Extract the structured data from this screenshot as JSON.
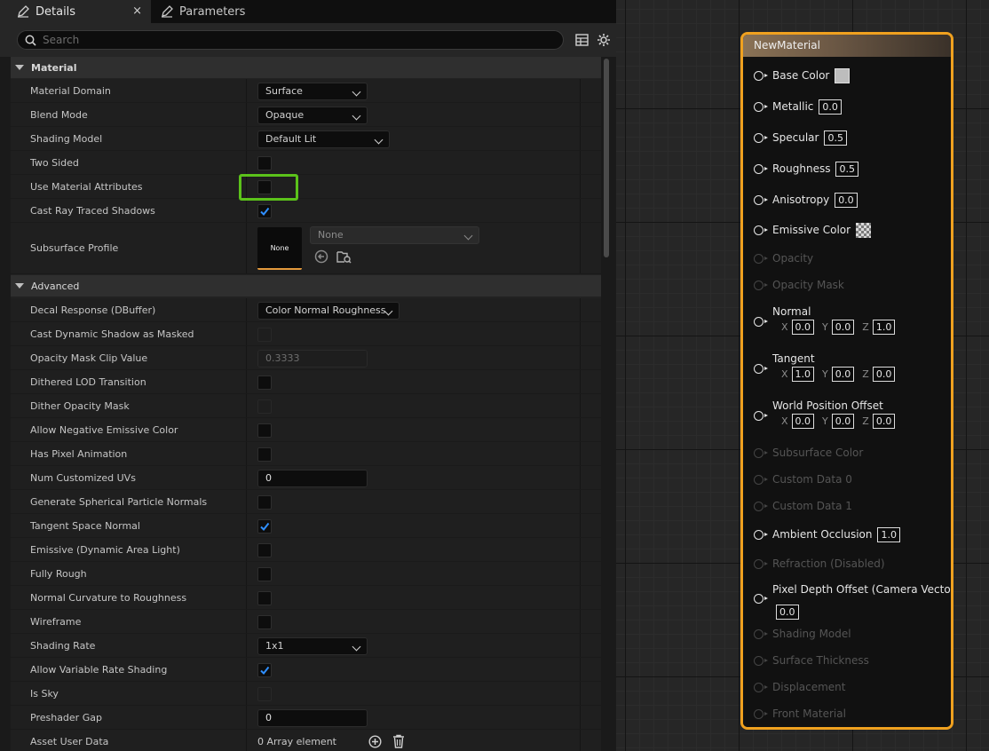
{
  "tabs": {
    "details": "Details",
    "parameters": "Parameters",
    "close": "×"
  },
  "search": {
    "placeholder": "Search"
  },
  "material_category": "Material",
  "advanced_category": "Advanced",
  "props": {
    "material_domain": {
      "label": "Material Domain",
      "value": "Surface"
    },
    "blend_mode": {
      "label": "Blend Mode",
      "value": "Opaque"
    },
    "shading_model": {
      "label": "Shading Model",
      "value": "Default Lit"
    },
    "two_sided": {
      "label": "Two Sided",
      "checked": false
    },
    "use_material_attributes": {
      "label": "Use Material Attributes",
      "checked": false
    },
    "cast_ray_traced_shadows": {
      "label": "Cast Ray Traced Shadows",
      "checked": true
    },
    "subsurface_profile": {
      "label": "Subsurface Profile",
      "thumb": "None",
      "value": "None"
    },
    "decal_response": {
      "label": "Decal Response (DBuffer)",
      "value": "Color Normal Roughness"
    },
    "cast_dynamic_shadow_masked": {
      "label": "Cast Dynamic Shadow as Masked",
      "checked": false,
      "disabled": true
    },
    "opacity_mask_clip": {
      "label": "Opacity Mask Clip Value",
      "value": "0.3333",
      "disabled": true
    },
    "dithered_lod": {
      "label": "Dithered LOD Transition",
      "checked": false
    },
    "dither_opacity_mask": {
      "label": "Dither Opacity Mask",
      "checked": false,
      "disabled": true
    },
    "allow_negative_emissive": {
      "label": "Allow Negative Emissive Color",
      "checked": false
    },
    "has_pixel_animation": {
      "label": "Has Pixel Animation",
      "checked": false
    },
    "num_customized_uvs": {
      "label": "Num Customized UVs",
      "value": "0"
    },
    "gen_spherical_normals": {
      "label": "Generate Spherical Particle Normals",
      "checked": false
    },
    "tangent_space_normal": {
      "label": "Tangent Space Normal",
      "checked": true
    },
    "emissive_area_light": {
      "label": "Emissive (Dynamic Area Light)",
      "checked": false
    },
    "fully_rough": {
      "label": "Fully Rough",
      "checked": false
    },
    "normal_curvature": {
      "label": "Normal Curvature to Roughness",
      "checked": false
    },
    "wireframe": {
      "label": "Wireframe",
      "checked": false
    },
    "shading_rate": {
      "label": "Shading Rate",
      "value": "1x1"
    },
    "allow_vrs": {
      "label": "Allow Variable Rate Shading",
      "checked": true
    },
    "is_sky": {
      "label": "Is Sky",
      "checked": false,
      "disabled": true
    },
    "preshader_gap": {
      "label": "Preshader Gap",
      "value": "0"
    },
    "asset_user_data": {
      "label": "Asset User Data",
      "value": "0 Array element"
    }
  },
  "node": {
    "title": "NewMaterial",
    "pins": {
      "base_color": "Base Color",
      "metallic": "Metallic",
      "metallic_val": "0.0",
      "specular": "Specular",
      "specular_val": "0.5",
      "roughness": "Roughness",
      "roughness_val": "0.5",
      "anisotropy": "Anisotropy",
      "anisotropy_val": "0.0",
      "emissive": "Emissive Color",
      "opacity": "Opacity",
      "opacity_mask": "Opacity Mask",
      "normal": "Normal",
      "normal_x": "0.0",
      "normal_y": "0.0",
      "normal_z": "1.0",
      "tangent": "Tangent",
      "tangent_x": "1.0",
      "tangent_y": "0.0",
      "tangent_z": "0.0",
      "wpo": "World Position Offset",
      "wpo_x": "0.0",
      "wpo_y": "0.0",
      "wpo_z": "0.0",
      "subsurface_color": "Subsurface Color",
      "custom_data_0": "Custom Data 0",
      "custom_data_1": "Custom Data 1",
      "ao": "Ambient Occlusion",
      "ao_val": "1.0",
      "refraction": "Refraction (Disabled)",
      "pdo": "Pixel Depth Offset (Camera Vector)",
      "pdo_val": "0.0",
      "shading_model": "Shading Model",
      "surface_thickness": "Surface Thickness",
      "displacement": "Displacement",
      "front_material": "Front Material"
    },
    "axes": {
      "x": "X",
      "y": "Y",
      "z": "Z"
    }
  },
  "colors": {
    "accent": "#f0a11f",
    "highlight": "#5bc21a",
    "check": "#2f8fff"
  }
}
